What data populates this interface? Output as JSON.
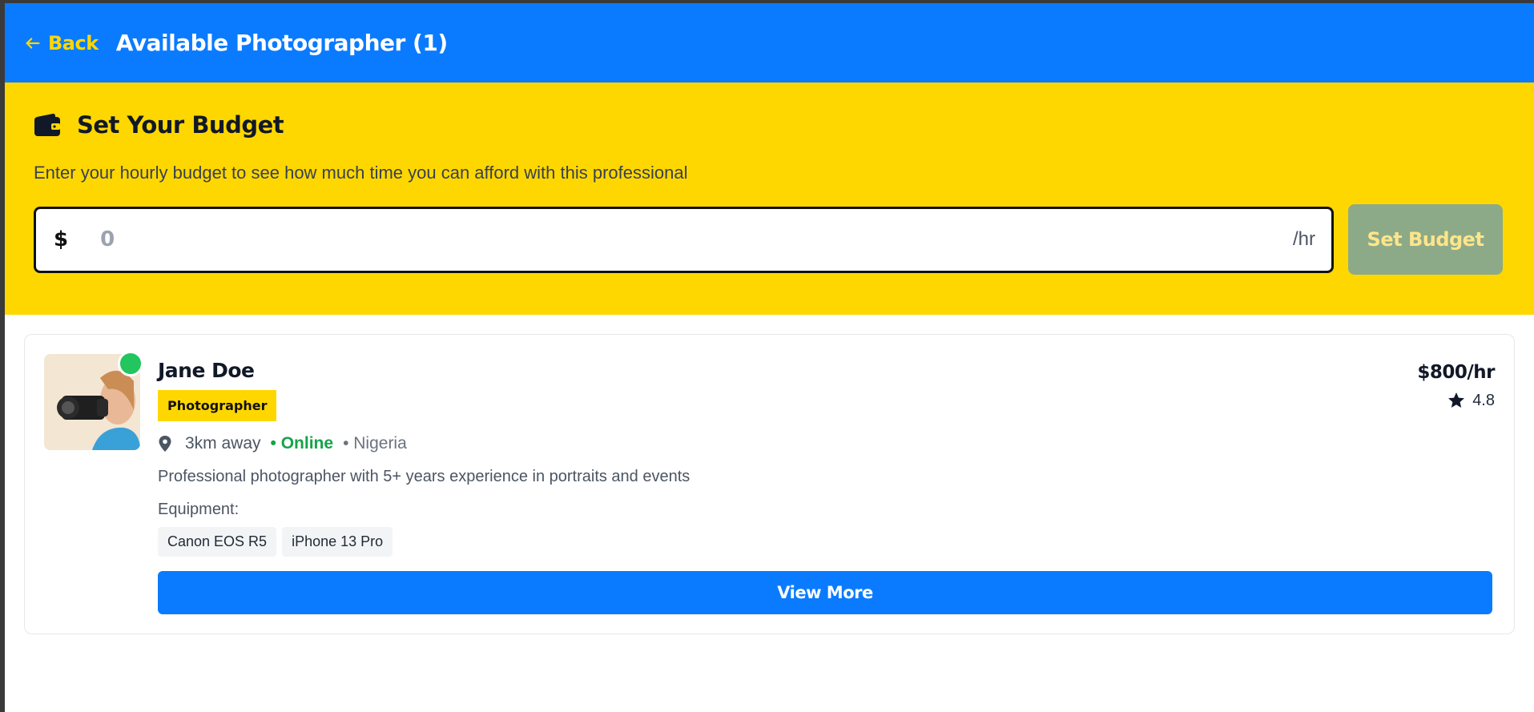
{
  "header": {
    "back_label": "Back",
    "title": "Available Photographer (1)"
  },
  "budget": {
    "title": "Set Your Budget",
    "description": "Enter your hourly budget to see how much time you can afford with this professional",
    "currency": "$",
    "amount_placeholder": "0",
    "unit": "/hr",
    "submit_label": "Set Budget"
  },
  "photographers": [
    {
      "name": "Jane Doe",
      "role": "Photographer",
      "distance": "3km away",
      "status": "• Online",
      "country": "• Nigeria",
      "description": "Professional photographer with 5+ years experience in portraits and events",
      "equipment_label": "Equipment:",
      "equipment": [
        "Canon EOS R5",
        "iPhone 13 Pro"
      ],
      "rate": "$800/hr",
      "rating": "4.8",
      "view_label": "View More",
      "online": true
    }
  ],
  "colors": {
    "primary": "#0A7BFF",
    "accent": "#FFD700",
    "online": "#22C55E",
    "disabled_button": "#8DAA88"
  },
  "icons": [
    "arrow-left-icon",
    "wallet-icon",
    "map-pin-icon",
    "star-icon"
  ]
}
